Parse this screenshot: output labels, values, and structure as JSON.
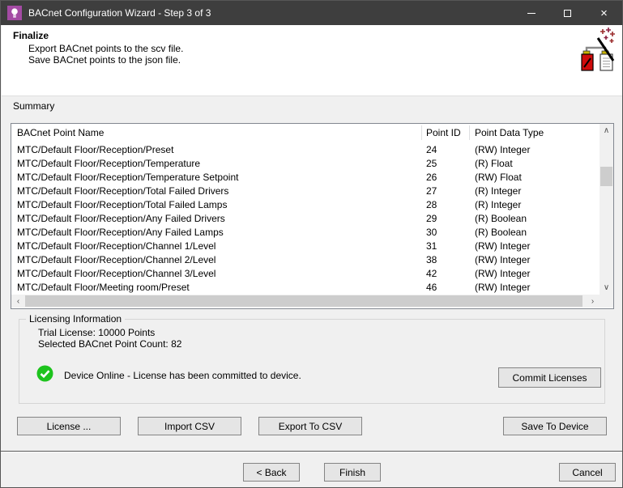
{
  "window": {
    "title": "BACnet Configuration Wizard - Step 3 of 3"
  },
  "icons": {
    "close": "×",
    "scroll_up": "∧",
    "scroll_down": "∨",
    "scroll_left": "‹",
    "scroll_right": "›"
  },
  "colors": {
    "titlebar_bg": "#3e3e3e",
    "app_icon_purple": "#a44ba4",
    "dialog_bg": "#f0f0f0",
    "header_bg": "#ffffff",
    "status_green": "#1dc31d"
  },
  "header": {
    "title": "Finalize",
    "line1": "Export BACnet points to the scv file.",
    "line2": "Save BACnet points to the json file."
  },
  "summary": {
    "label": "Summary",
    "columns": [
      "BACnet Point Name",
      "Point ID",
      "Point Data Type"
    ],
    "rows": [
      {
        "name": "MTC/Default Floor/Reception/Preset",
        "id": "24",
        "type": "(RW) Integer"
      },
      {
        "name": "MTC/Default Floor/Reception/Temperature",
        "id": "25",
        "type": "(R) Float"
      },
      {
        "name": "MTC/Default Floor/Reception/Temperature Setpoint",
        "id": "26",
        "type": "(RW) Float"
      },
      {
        "name": "MTC/Default Floor/Reception/Total Failed Drivers",
        "id": "27",
        "type": "(R) Integer"
      },
      {
        "name": "MTC/Default Floor/Reception/Total Failed Lamps",
        "id": "28",
        "type": "(R) Integer"
      },
      {
        "name": "MTC/Default Floor/Reception/Any Failed Drivers",
        "id": "29",
        "type": "(R) Boolean"
      },
      {
        "name": "MTC/Default Floor/Reception/Any Failed Lamps",
        "id": "30",
        "type": "(R) Boolean"
      },
      {
        "name": "MTC/Default Floor/Reception/Channel 1/Level",
        "id": "31",
        "type": "(RW) Integer"
      },
      {
        "name": "MTC/Default Floor/Reception/Channel 2/Level",
        "id": "38",
        "type": "(RW) Integer"
      },
      {
        "name": "MTC/Default Floor/Reception/Channel 3/Level",
        "id": "42",
        "type": "(RW) Integer"
      },
      {
        "name": "MTC/Default Floor/Meeting room/Preset",
        "id": "46",
        "type": "(RW) Integer"
      }
    ]
  },
  "licensing": {
    "label": "Licensing Information",
    "trial_license": "Trial License: 10000 Points",
    "point_count": "Selected BACnet Point Count: 82",
    "status": "Device Online - License has been committed to device.",
    "commit_button": "Commit Licenses"
  },
  "actions": {
    "license": "License ...",
    "import_csv": "Import CSV",
    "export_csv": "Export To CSV",
    "save_to_device": "Save To Device"
  },
  "footer": {
    "back": "< Back",
    "finish": "Finish",
    "cancel": "Cancel"
  }
}
